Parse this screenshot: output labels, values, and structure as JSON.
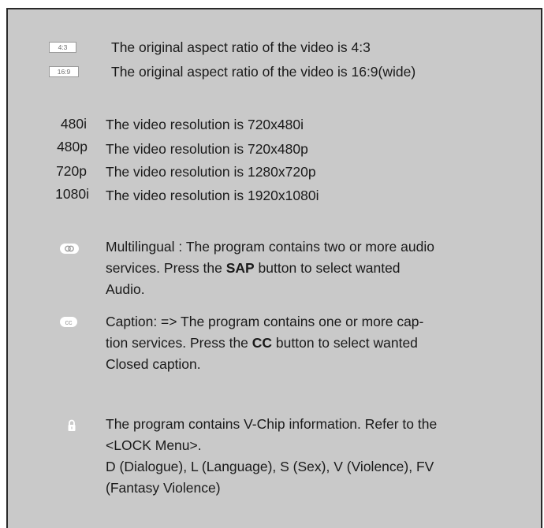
{
  "aspect": [
    {
      "badge": "4:3",
      "text": "The original aspect ratio of the video is 4:3"
    },
    {
      "badge": "16:9",
      "text": "The original aspect ratio of the video is 16:9(wide)"
    }
  ],
  "resolutions": [
    {
      "label": "480i",
      "text": "The video resolution is 720x480i"
    },
    {
      "label": "480p",
      "text": "The video resolution is 720x480p"
    },
    {
      "label": "720p",
      "text": "The video resolution is 1280x720p"
    },
    {
      "label": "1080i",
      "text": "The video resolution is 1920x1080i"
    }
  ],
  "multilingual": {
    "icon": "multilingual-icon",
    "line1": "Multilingual : The program contains two or more audio",
    "line2_pre": "services. Press the ",
    "line2_bold": "SAP",
    "line2_post": " button to select wanted",
    "line3": "Audio."
  },
  "caption": {
    "icon": "cc-icon",
    "line1": "Caption: => The program contains one or more cap-",
    "line2_pre": "tion services. Press the ",
    "line2_bold": "CC",
    "line2_post": " button to select wanted",
    "line3": "Closed caption."
  },
  "vchip": {
    "icon": "lock-icon",
    "line1": "The program contains V-Chip information. Refer to the",
    "line2": "<LOCK Menu>.",
    "line3": "D (Dialogue), L (Language), S (Sex), V (Violence), FV",
    "line4": "(Fantasy Violence)"
  }
}
